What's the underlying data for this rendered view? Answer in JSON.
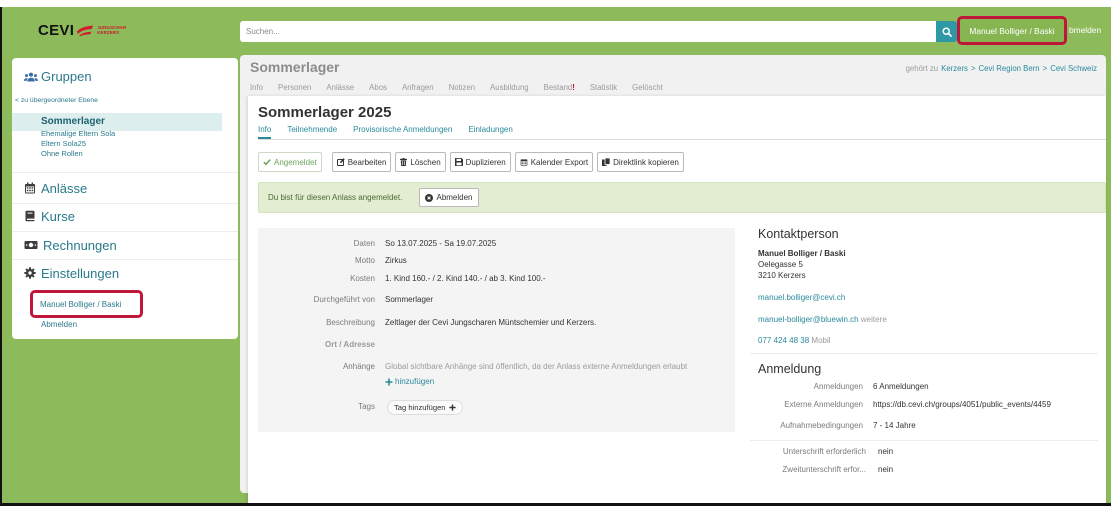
{
  "header": {
    "logo": {
      "name": "CEVI",
      "line1": "JUNGSCHAR",
      "line2": "KERZERS"
    },
    "search": {
      "placeholder": "Suchen...",
      "button_icon": "search-icon"
    },
    "user_label": "Manuel Bolliger / Baski",
    "logout_label": "bmelden"
  },
  "sidebar": {
    "groups_title": "Gruppen",
    "groups_icon": "users-icon",
    "parent_link": "< zu übergeordneter Ebene",
    "selected_group": "Sommerlager",
    "subgroups": [
      "Ehemalige Eltern Sola",
      "Eltern Sola25",
      "Ohne Rollen"
    ],
    "sections": [
      {
        "label": "Anlässe",
        "icon": "calendar-icon"
      },
      {
        "label": "Kurse",
        "icon": "book-icon"
      },
      {
        "label": "Rechnungen",
        "icon": "money-icon"
      },
      {
        "label": "Einstellungen",
        "icon": "gear-icon"
      }
    ],
    "settings_items": [
      "Manuel Bolliger / Baski",
      "Abmelden"
    ]
  },
  "group": {
    "title": "Sommerlager",
    "tabs": [
      {
        "label": "Info"
      },
      {
        "label": "Personen"
      },
      {
        "label": "Anlässe"
      },
      {
        "label": "Abos"
      },
      {
        "label": "Anfragen"
      },
      {
        "label": "Notizen"
      },
      {
        "label": "Ausbildung"
      },
      {
        "label": "Bestand",
        "alert": "!"
      },
      {
        "label": "Statistik"
      },
      {
        "label": "Gelöscht"
      }
    ],
    "belongs_to": {
      "prefix": "gehört zu",
      "path": [
        "Kerzers",
        "Cevi Region Bern",
        "Cevi Schweiz"
      ],
      "separator": ">"
    }
  },
  "event": {
    "title": "Sommerlager 2025",
    "tabs": [
      "Info",
      "Teilnehmende",
      "Provisorische Anmeldungen",
      "Einladungen"
    ],
    "active_tab": "Info",
    "actions": [
      {
        "label": "Angemeldet",
        "icon": "check-icon",
        "state": "disabled"
      },
      {
        "label": "Bearbeiten",
        "icon": "edit-icon"
      },
      {
        "label": "Löschen",
        "icon": "trash-icon"
      },
      {
        "label": "Duplizieren",
        "icon": "save-icon"
      },
      {
        "label": "Kalender Export",
        "icon": "calendar-icon"
      },
      {
        "label": "Direktlink kopieren",
        "icon": "copy-icon"
      }
    ],
    "alert": {
      "text": "Du bist für diesen Anlass angemeldet.",
      "button": "Abmelden",
      "button_icon": "x-circle-icon"
    },
    "details": [
      {
        "label": "Daten",
        "value": "So 13.07.2025 - Sa 19.07.2025"
      },
      {
        "label": "Motto",
        "value": "Zirkus"
      },
      {
        "label": "Kosten",
        "value": "1. Kind 160.- / 2. Kind 140.- / ab 3. Kind 100.-"
      },
      {
        "label": "Durchgeführt von",
        "value": "Sommerlager"
      },
      {
        "label": "Beschreibung",
        "value": "Zeltlager der Cevi Jungscharen Müntschemier und Kerzers."
      },
      {
        "label": "Ort / Adresse",
        "value": ""
      }
    ],
    "attachments": {
      "label": "Anhänge",
      "note": "Global sichtbare Anhänge sind öffentlich, da der Anlass externe Anmeldungen erlaubt",
      "add_label": "hinzufügen",
      "add_icon": "plus-icon"
    },
    "tags": {
      "label": "Tags",
      "add_label": "Tag hinzufügen",
      "add_icon": "plus-icon"
    },
    "contact": {
      "title": "Kontaktperson",
      "name": "Manuel Bolliger / Baski",
      "street": "Oelegasse 5",
      "city": "3210 Kerzers",
      "email_primary": "manuel.bolliger@cevi.ch",
      "email_secondary": {
        "address": "manuel-bolliger@bluewin.ch",
        "type": "weitere"
      },
      "phone": {
        "number": "077 424 48 38",
        "type": "Mobil"
      }
    },
    "registration": {
      "title": "Anmeldung",
      "rows": [
        {
          "label": "Anmeldungen",
          "value": "6 Anmeldungen"
        },
        {
          "label": "Externe Anmeldungen",
          "value": "https://db.cevi.ch/groups/4051/public_events/4459"
        },
        {
          "label": "Aufnahmebedingungen",
          "value": "7 - 14 Jahre"
        }
      ],
      "signature_rows": [
        {
          "label": "Unterschrift erforderlich",
          "value": "nein"
        },
        {
          "label": "Zweitunterschrift erfor...",
          "value": "nein"
        }
      ]
    }
  },
  "colors": {
    "background": "#8dba5b",
    "accent": "#2a8a9c",
    "highlight_border": "#c0163a",
    "alert_background": "#e2edd2",
    "alert_text": "#4e6a33",
    "tab_alert": "#d0021b"
  }
}
